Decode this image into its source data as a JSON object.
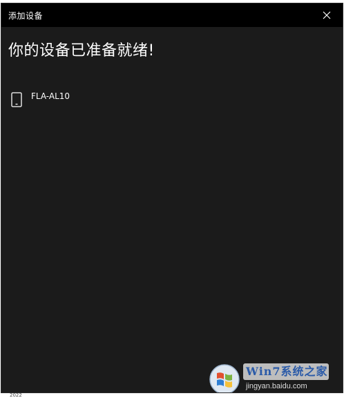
{
  "window": {
    "title": "添加设备",
    "heading": "你的设备已准备就绪!",
    "close_icon": "close-icon"
  },
  "devices": [
    {
      "name": "FLA-AL10",
      "icon": "phone-icon"
    }
  ],
  "watermark": {
    "brand": "Win7系统之家",
    "url": "jingyan.baidu.com",
    "logo_icon": "windows-logo-icon"
  },
  "footer": {
    "text": "2022"
  },
  "colors": {
    "window_bg": "#1b1b1b",
    "titlebar_bg": "#000000",
    "text": "#ffffff"
  }
}
